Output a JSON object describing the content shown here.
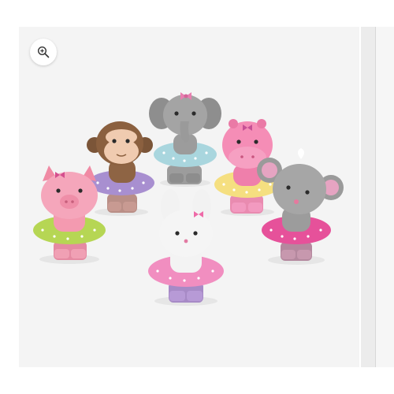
{
  "gallery": {
    "zoom_button": {
      "icon": "zoom-in-icon"
    },
    "product_image": {
      "figures": [
        "pig-figure",
        "monkey-figure",
        "elephant-figure",
        "hippo-figure",
        "mouse-figure",
        "bunny-figure"
      ]
    }
  },
  "colors": {
    "frame_background": "#f4f4f4",
    "page_background": "#ffffff"
  }
}
